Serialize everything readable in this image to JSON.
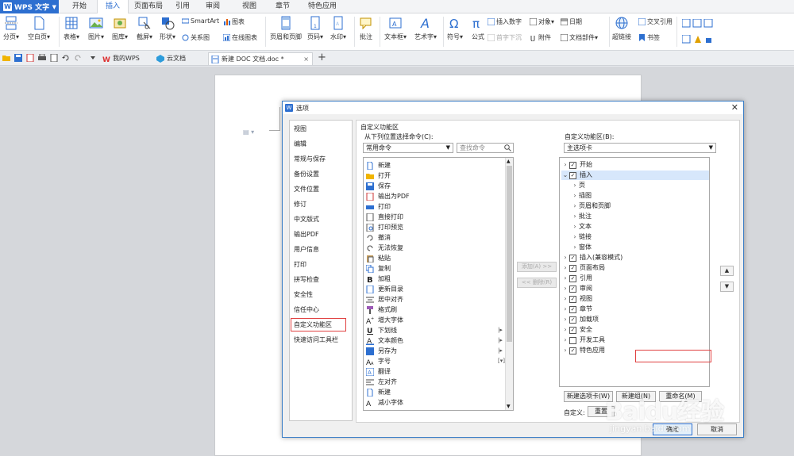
{
  "app": {
    "name": "WPS 文字"
  },
  "ribbon_tabs": [
    "开始",
    "插入",
    "页面布局",
    "引用",
    "审阅",
    "视图",
    "章节",
    "特色应用"
  ],
  "ribbon": {
    "page_break": "分页",
    "blank_page": "空白页",
    "table": "表格",
    "picture": "图片",
    "gallery": "图库",
    "screenshot": "截屏",
    "shapes": "形状",
    "smartart": "SmartArt",
    "chart": "图表",
    "relation": "关系图",
    "online_chart": "在线图表",
    "header_footer": "页眉和页脚",
    "page_number": "页码",
    "watermark": "水印",
    "comment": "批注",
    "textbox": "文本框",
    "wordart": "艺术字",
    "symbol": "符号",
    "formula": "公式",
    "insert_number": "插入数字",
    "object": "对象",
    "date": "日期",
    "first_char": "首字下沉",
    "attachment": "附件",
    "doc_parts": "文档部件",
    "hyperlink": "超链接",
    "cross_ref": "交叉引用",
    "bookmark": "书签"
  },
  "doc_tabs": {
    "my_wps": "我的WPS",
    "cloud": "云文档",
    "active_doc": "新建 DOC 文档.doc *"
  },
  "dialog": {
    "title": "选项",
    "nav_items": [
      "视图",
      "编辑",
      "常规与保存",
      "备份设置",
      "文件位置",
      "修订",
      "中文版式",
      "输出PDF",
      "用户信息",
      "打印",
      "拼写检查",
      "安全性",
      "信任中心",
      "自定义功能区",
      "快速访问工具栏"
    ],
    "section_title": "自定义功能区",
    "choose_label": "从下列位置选择命令(C):",
    "choose_value": "常用命令",
    "search_placeholder": "查找命令",
    "commands": [
      "新建",
      "打开",
      "保存",
      "输出为PDF",
      "打印",
      "直接打印",
      "打印预览",
      "撤消",
      "无法恢复",
      "粘贴",
      "复制",
      "加粗",
      "更新目录",
      "居中对齐",
      "格式刷",
      "增大字体",
      "下划线",
      "文本颜色",
      "另存为",
      "字号",
      "翻译",
      "左对齐",
      "新建",
      "减小字体"
    ],
    "add_btn": "添加(A) >>",
    "remove_btn": "<< 删除(R)",
    "custom_label": "自定义功能区(B):",
    "custom_value": "主选项卡",
    "tree": [
      {
        "label": "开始",
        "checked": true,
        "level": 0,
        "expanded": false
      },
      {
        "label": "插入",
        "checked": true,
        "level": 0,
        "expanded": true
      },
      {
        "label": "页",
        "level": 1
      },
      {
        "label": "插图",
        "level": 1
      },
      {
        "label": "页眉和页脚",
        "level": 1
      },
      {
        "label": "批注",
        "level": 1
      },
      {
        "label": "文本",
        "level": 1
      },
      {
        "label": "链接",
        "level": 1
      },
      {
        "label": "窗体",
        "level": 1
      },
      {
        "label": "插入(兼容模式)",
        "checked": true,
        "level": 0,
        "expanded": false
      },
      {
        "label": "页面布局",
        "checked": true,
        "level": 0,
        "expanded": false
      },
      {
        "label": "引用",
        "checked": true,
        "level": 0,
        "expanded": false
      },
      {
        "label": "审阅",
        "checked": true,
        "level": 0,
        "expanded": false
      },
      {
        "label": "视图",
        "checked": true,
        "level": 0,
        "expanded": false
      },
      {
        "label": "章节",
        "checked": true,
        "level": 0,
        "expanded": false
      },
      {
        "label": "加载项",
        "checked": true,
        "level": 0,
        "expanded": false
      },
      {
        "label": "安全",
        "checked": true,
        "level": 0,
        "expanded": false
      },
      {
        "label": "开发工具",
        "checked": false,
        "level": 0,
        "expanded": false
      },
      {
        "label": "特色应用",
        "checked": true,
        "level": 0,
        "expanded": false
      }
    ],
    "new_tab_btn": "新建选项卡(W)",
    "new_group_btn": "新建组(N)",
    "rename_btn": "重命名(M)",
    "customize_label": "自定义:",
    "reset_btn": "重置",
    "ok_btn": "确定",
    "cancel_btn": "取消"
  },
  "watermark": {
    "brand": "Baidu经验",
    "site": "jingyan.baidu.com"
  }
}
